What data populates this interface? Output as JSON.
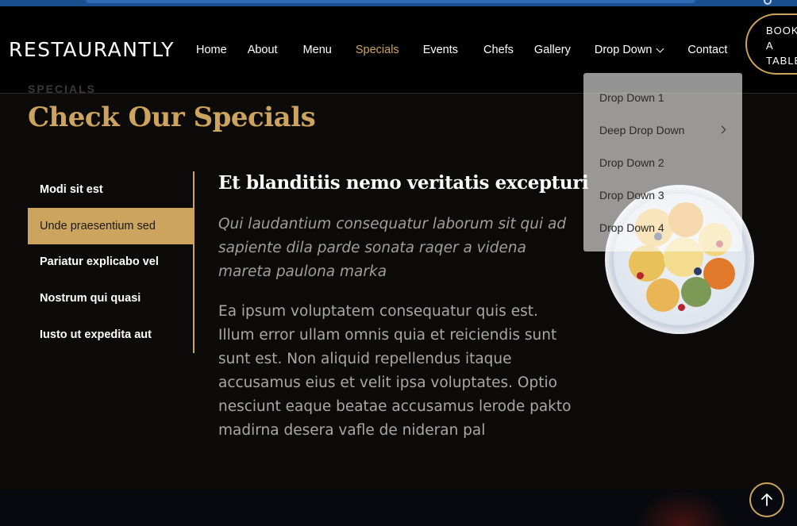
{
  "header": {
    "logo": "RESTAURANTLY",
    "nav": [
      {
        "label": "Home",
        "active": false
      },
      {
        "label": "About",
        "active": false
      },
      {
        "label": "Menu",
        "active": false
      },
      {
        "label": "Specials",
        "active": true
      },
      {
        "label": "Events",
        "active": false
      },
      {
        "label": "Chefs",
        "active": false
      },
      {
        "label": "Gallery",
        "active": false
      },
      {
        "label": "Drop Down",
        "active": false,
        "has_dropdown": true
      },
      {
        "label": "Contact",
        "active": false
      }
    ],
    "book_button": [
      "BOOK",
      "A",
      "TABLE"
    ]
  },
  "dropdown": {
    "items": [
      {
        "label": "Drop Down 1"
      },
      {
        "label": "Deep Drop Down",
        "has_submenu": true
      },
      {
        "label": "Drop Down 2"
      },
      {
        "label": "Drop Down 3"
      },
      {
        "label": "Drop Down 4"
      }
    ]
  },
  "specials": {
    "label": "SPECIALS",
    "title": "Check Our Specials",
    "tabs": [
      {
        "label": "Modi sit est",
        "active": false
      },
      {
        "label": "Unde praesentium sed",
        "active": true
      },
      {
        "label": "Pariatur explicabo vel",
        "active": false
      },
      {
        "label": "Nostrum qui quasi",
        "active": false
      },
      {
        "label": "Iusto ut expedita aut",
        "active": false
      }
    ],
    "content": {
      "title": "Et blanditiis nemo veritatis excepturi",
      "italic": "Qui laudantium consequatur laborum sit qui ad sapiente dila parde sonata raqer a videna mareta paulona marka",
      "body": "Ea ipsum voluptatem consequatur quis est. Illum error ullam omnis quia et reiciendis sunt sunt est. Non aliquid repellendus itaque accusamus eius et velit ipsa voluptates. Optio nesciunt eaque beatae accusamus lerode pakto madirna desera vafle de nideran pal"
    }
  },
  "colors": {
    "accent": "#cda45e",
    "background": "#0c0b09",
    "header": "#000000"
  },
  "icons": {
    "back_to_top": "arrow-up-icon",
    "dropdown": "chevron-down-icon",
    "submenu": "chevron-right-icon"
  }
}
